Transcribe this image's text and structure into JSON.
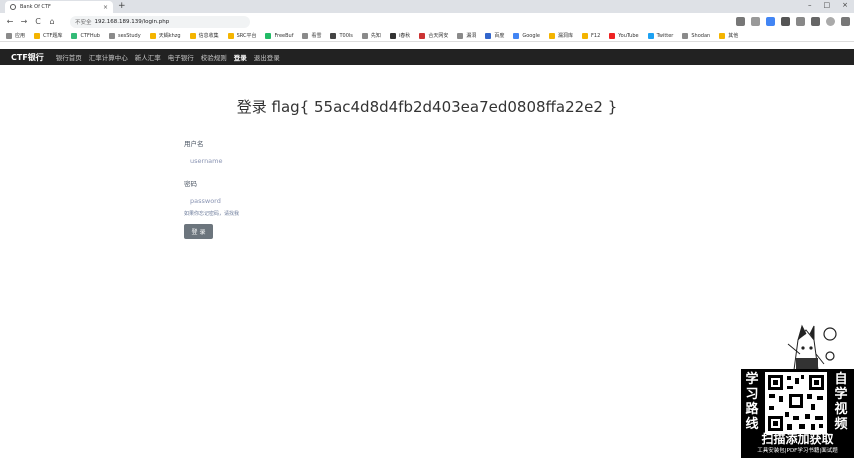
{
  "browser": {
    "tab_title": "Bank Of CTF",
    "tab_close": "×",
    "new_tab": "+",
    "window_controls": [
      "–",
      "□",
      "×"
    ],
    "address_warning": "不安全",
    "address_host": "192.168.189.139",
    "address_path": "/login.php",
    "nav": {
      "back": "←",
      "forward": "→",
      "reload": "C",
      "home": "⌂"
    }
  },
  "bookmarks": [
    "应用",
    "CTF题库",
    "CTFHub",
    "sesStudy",
    "天蝎khzg",
    "信息收集",
    "SRC平台",
    "FreeBuf",
    "看雪",
    "T00ls",
    "先知",
    "i春秋",
    "合天网安",
    "漏洞",
    "百度",
    "Google",
    "漏洞库",
    "F12",
    "YouTube",
    "Twitter",
    "Shodan",
    "其他"
  ],
  "site_nav": {
    "brand": "CTF银行",
    "links": [
      "银行首页",
      "汇率计算中心",
      "新人汇率",
      "电子银行",
      "校验规则",
      "登录",
      "退出登录"
    ],
    "active_index": 5
  },
  "login": {
    "title": "登录 flag{ 55ac4d8d4fb2d403ea7ed0808ffa22e2 }",
    "username_label": "用户名",
    "username_placeholder": "username",
    "password_label": "密码",
    "password_placeholder": "password",
    "hint": "如果你忘记密码，请找我",
    "submit_label": "登 录"
  },
  "promo": {
    "left_chars": "学习路线",
    "right_chars": "自学视频",
    "scan_text": "扫描添加获取",
    "tools_text": "工具安装包|PDF学习书籍|面试题"
  },
  "colors": {
    "navbar": "#222222",
    "button": "#6c757d",
    "placeholder": "#8a94b3"
  }
}
